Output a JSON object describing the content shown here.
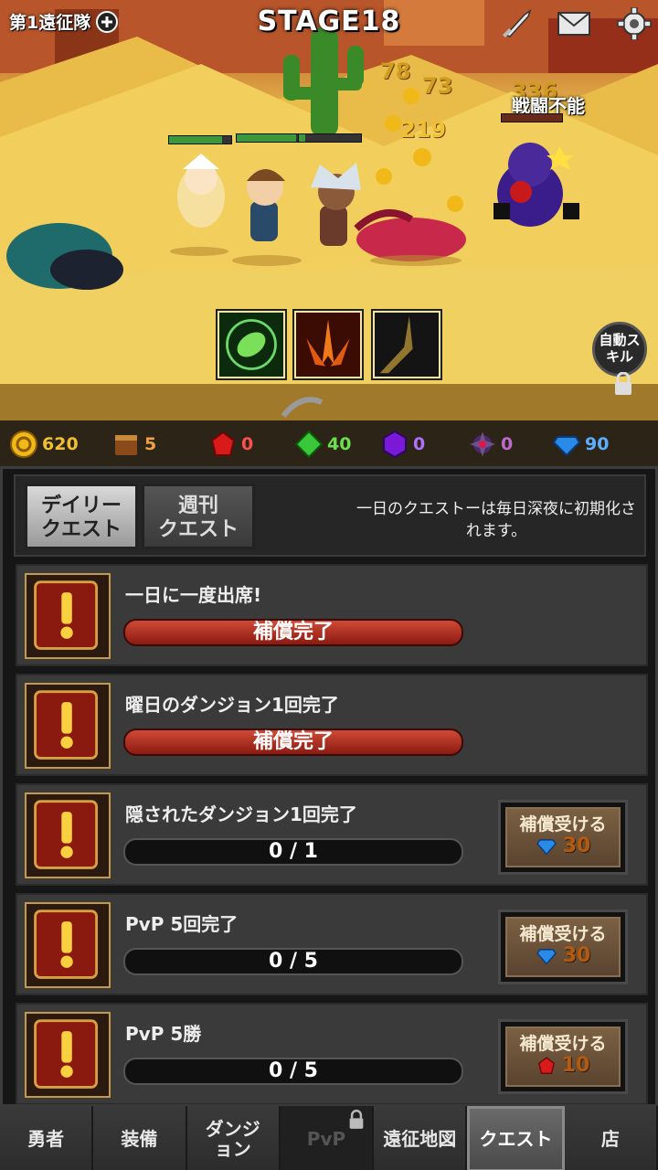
{
  "header": {
    "party_label": "第1遠征隊",
    "stage_label": "STAGE18",
    "icons": [
      "plus-icon",
      "sword-icon",
      "mail-icon",
      "gear-icon"
    ]
  },
  "battle": {
    "floating_numbers": [
      "78",
      "73",
      "219",
      "336"
    ],
    "enemy_status": "戦闘不能",
    "auto_skill_label": "自動スキル",
    "skills": [
      "leaf-skill-icon",
      "flame-spikes-skill-icon",
      "dark-slash-skill-icon"
    ]
  },
  "currency": [
    {
      "name": "gold-coin-icon",
      "value": "620"
    },
    {
      "name": "book-icon",
      "value": "5"
    },
    {
      "name": "red-gem-icon",
      "value": "0"
    },
    {
      "name": "green-gem-icon",
      "value": "40"
    },
    {
      "name": "purple-gem-icon",
      "value": "0"
    },
    {
      "name": "dark-orb-icon",
      "value": "0"
    },
    {
      "name": "blue-diamond-icon",
      "value": "90"
    }
  ],
  "quest_panel": {
    "tabs": [
      {
        "label": "デイリー\nクエスト",
        "active": true
      },
      {
        "label": "週刊\nクエスト",
        "active": false
      }
    ],
    "reset_note": "一日のクエストーは毎日深夜に初期化されます。",
    "quests": [
      {
        "title": "一日に一度出席!",
        "progress_text": "補償完了",
        "status": "completed"
      },
      {
        "title": "曜日のダンジョン1回完了",
        "progress_text": "補償完了",
        "status": "completed"
      },
      {
        "title": "隠されたダンジョン1回完了",
        "progress_text": "0 / 1",
        "status": "in-progress",
        "claim_label": "補償受ける",
        "reward_icon": "blue-diamond-icon",
        "reward_amount": "30"
      },
      {
        "title": "PvP 5回完了",
        "progress_text": "0 / 5",
        "status": "in-progress",
        "claim_label": "補償受ける",
        "reward_icon": "blue-diamond-icon",
        "reward_amount": "30"
      },
      {
        "title": "PvP 5勝",
        "progress_text": "0 / 5",
        "status": "in-progress",
        "claim_label": "補償受ける",
        "reward_icon": "red-gem-icon",
        "reward_amount": "10"
      }
    ]
  },
  "nav": [
    {
      "label": "勇者",
      "state": "normal"
    },
    {
      "label": "装備",
      "state": "normal"
    },
    {
      "label": "ダンジ\nョン",
      "state": "normal"
    },
    {
      "label": "PvP",
      "state": "locked"
    },
    {
      "label": "遠征地図",
      "state": "normal"
    },
    {
      "label": "クエスト",
      "state": "active"
    },
    {
      "label": "店",
      "state": "normal"
    }
  ],
  "colors": {
    "gold": "#f0b818",
    "completed_bar": "#b32a1c",
    "panel_bg": "#161616",
    "hp_green": "#3a9a3a"
  }
}
